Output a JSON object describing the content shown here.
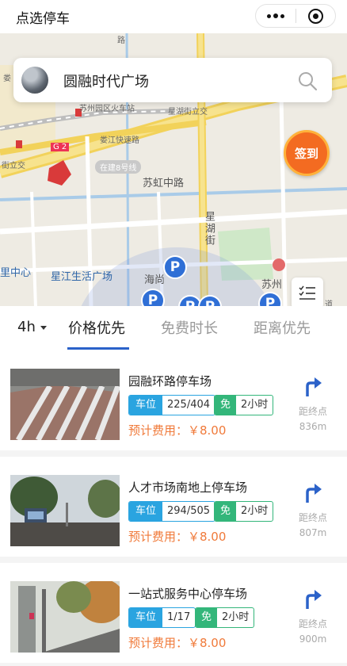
{
  "header": {
    "title": "点选停车"
  },
  "search": {
    "destination": "圆融时代广场"
  },
  "map": {
    "labels": {
      "station": "苏州园区火车站",
      "interchange": "星湖街立交",
      "expressway": "娄江快速路",
      "left_interchange": "街立交",
      "construction": "在建8号线",
      "road_suhong": "苏虹中路",
      "road_xinghu": "星湖街",
      "center": "里中心",
      "plaza": "星江生活广场",
      "haishang": "海尚",
      "suzhou": "苏州",
      "road_right": "道",
      "left_top": "娄",
      "g_badge": "G 2",
      "road_tag": "路"
    },
    "checkin_label": "签到"
  },
  "filter": {
    "duration": "4h",
    "tabs": [
      "价格优先",
      "免费时长",
      "距离优先"
    ],
    "active_tab": 0
  },
  "parking": [
    {
      "name": "园融环路停车场",
      "spot_label": "车位",
      "spots": "225/404",
      "free_label": "免",
      "free_time": "2小时",
      "fee": "预计费用：￥8.00",
      "nav_label": "距终点",
      "distance": "836m"
    },
    {
      "name": "人才市场南地上停车场",
      "spot_label": "车位",
      "spots": "294/505",
      "free_label": "免",
      "free_time": "2小时",
      "fee": "预计费用：￥8.00",
      "nav_label": "距终点",
      "distance": "807m"
    },
    {
      "name": "一站式服务中心停车场",
      "spot_label": "车位",
      "spots": "1/17",
      "free_label": "免",
      "free_time": "2小时",
      "fee": "预计费用：￥8.00",
      "nav_label": "距终点",
      "distance": "900m"
    }
  ],
  "colors": {
    "accent": "#2b62c9",
    "spot_badge": "#2aa4e0",
    "free_badge": "#33b67a",
    "fee": "#f07a3a",
    "pin": "#2f6fd6",
    "checkin": "#f36b21"
  },
  "icons": {
    "more": "more-dots-icon",
    "close": "target-icon",
    "search": "search-icon",
    "list": "list-icon",
    "navigate": "turn-right-arrow-icon",
    "parking_pin": "parking-pin-icon"
  }
}
